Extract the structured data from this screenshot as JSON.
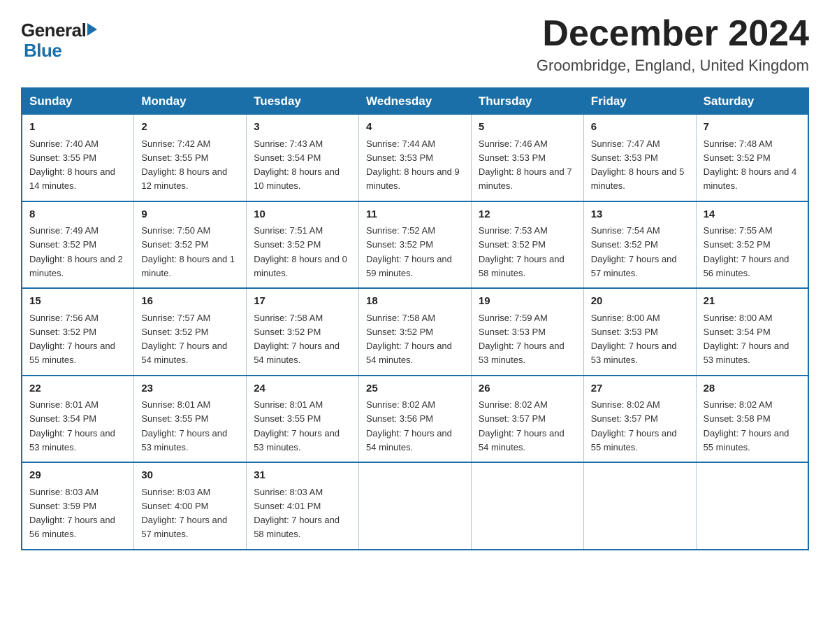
{
  "header": {
    "logo_general": "General",
    "logo_blue": "Blue",
    "main_title": "December 2024",
    "subtitle": "Groombridge, England, United Kingdom"
  },
  "days_of_week": [
    "Sunday",
    "Monday",
    "Tuesday",
    "Wednesday",
    "Thursday",
    "Friday",
    "Saturday"
  ],
  "weeks": [
    [
      {
        "day": "1",
        "sunrise": "7:40 AM",
        "sunset": "3:55 PM",
        "daylight": "8 hours and 14 minutes."
      },
      {
        "day": "2",
        "sunrise": "7:42 AM",
        "sunset": "3:55 PM",
        "daylight": "8 hours and 12 minutes."
      },
      {
        "day": "3",
        "sunrise": "7:43 AM",
        "sunset": "3:54 PM",
        "daylight": "8 hours and 10 minutes."
      },
      {
        "day": "4",
        "sunrise": "7:44 AM",
        "sunset": "3:53 PM",
        "daylight": "8 hours and 9 minutes."
      },
      {
        "day": "5",
        "sunrise": "7:46 AM",
        "sunset": "3:53 PM",
        "daylight": "8 hours and 7 minutes."
      },
      {
        "day": "6",
        "sunrise": "7:47 AM",
        "sunset": "3:53 PM",
        "daylight": "8 hours and 5 minutes."
      },
      {
        "day": "7",
        "sunrise": "7:48 AM",
        "sunset": "3:52 PM",
        "daylight": "8 hours and 4 minutes."
      }
    ],
    [
      {
        "day": "8",
        "sunrise": "7:49 AM",
        "sunset": "3:52 PM",
        "daylight": "8 hours and 2 minutes."
      },
      {
        "day": "9",
        "sunrise": "7:50 AM",
        "sunset": "3:52 PM",
        "daylight": "8 hours and 1 minute."
      },
      {
        "day": "10",
        "sunrise": "7:51 AM",
        "sunset": "3:52 PM",
        "daylight": "8 hours and 0 minutes."
      },
      {
        "day": "11",
        "sunrise": "7:52 AM",
        "sunset": "3:52 PM",
        "daylight": "7 hours and 59 minutes."
      },
      {
        "day": "12",
        "sunrise": "7:53 AM",
        "sunset": "3:52 PM",
        "daylight": "7 hours and 58 minutes."
      },
      {
        "day": "13",
        "sunrise": "7:54 AM",
        "sunset": "3:52 PM",
        "daylight": "7 hours and 57 minutes."
      },
      {
        "day": "14",
        "sunrise": "7:55 AM",
        "sunset": "3:52 PM",
        "daylight": "7 hours and 56 minutes."
      }
    ],
    [
      {
        "day": "15",
        "sunrise": "7:56 AM",
        "sunset": "3:52 PM",
        "daylight": "7 hours and 55 minutes."
      },
      {
        "day": "16",
        "sunrise": "7:57 AM",
        "sunset": "3:52 PM",
        "daylight": "7 hours and 54 minutes."
      },
      {
        "day": "17",
        "sunrise": "7:58 AM",
        "sunset": "3:52 PM",
        "daylight": "7 hours and 54 minutes."
      },
      {
        "day": "18",
        "sunrise": "7:58 AM",
        "sunset": "3:52 PM",
        "daylight": "7 hours and 54 minutes."
      },
      {
        "day": "19",
        "sunrise": "7:59 AM",
        "sunset": "3:53 PM",
        "daylight": "7 hours and 53 minutes."
      },
      {
        "day": "20",
        "sunrise": "8:00 AM",
        "sunset": "3:53 PM",
        "daylight": "7 hours and 53 minutes."
      },
      {
        "day": "21",
        "sunrise": "8:00 AM",
        "sunset": "3:54 PM",
        "daylight": "7 hours and 53 minutes."
      }
    ],
    [
      {
        "day": "22",
        "sunrise": "8:01 AM",
        "sunset": "3:54 PM",
        "daylight": "7 hours and 53 minutes."
      },
      {
        "day": "23",
        "sunrise": "8:01 AM",
        "sunset": "3:55 PM",
        "daylight": "7 hours and 53 minutes."
      },
      {
        "day": "24",
        "sunrise": "8:01 AM",
        "sunset": "3:55 PM",
        "daylight": "7 hours and 53 minutes."
      },
      {
        "day": "25",
        "sunrise": "8:02 AM",
        "sunset": "3:56 PM",
        "daylight": "7 hours and 54 minutes."
      },
      {
        "day": "26",
        "sunrise": "8:02 AM",
        "sunset": "3:57 PM",
        "daylight": "7 hours and 54 minutes."
      },
      {
        "day": "27",
        "sunrise": "8:02 AM",
        "sunset": "3:57 PM",
        "daylight": "7 hours and 55 minutes."
      },
      {
        "day": "28",
        "sunrise": "8:02 AM",
        "sunset": "3:58 PM",
        "daylight": "7 hours and 55 minutes."
      }
    ],
    [
      {
        "day": "29",
        "sunrise": "8:03 AM",
        "sunset": "3:59 PM",
        "daylight": "7 hours and 56 minutes."
      },
      {
        "day": "30",
        "sunrise": "8:03 AM",
        "sunset": "4:00 PM",
        "daylight": "7 hours and 57 minutes."
      },
      {
        "day": "31",
        "sunrise": "8:03 AM",
        "sunset": "4:01 PM",
        "daylight": "7 hours and 58 minutes."
      },
      null,
      null,
      null,
      null
    ]
  ]
}
